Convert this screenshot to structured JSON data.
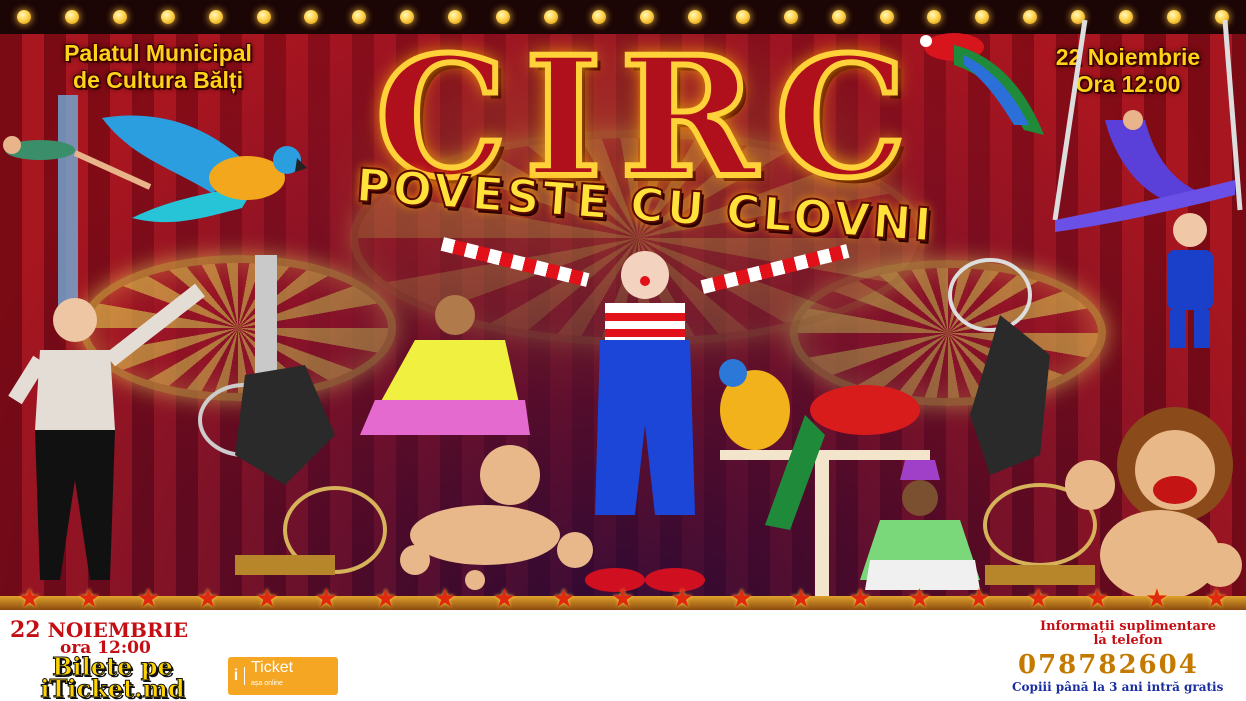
{
  "header": {
    "venue_line1": "Palatul Municipal",
    "venue_line2": "de Cultura Bălți",
    "date_line1": "22 Noiembrie",
    "date_line2": "Ora 12:00"
  },
  "title": "CIRC",
  "subtitle": "POVESTE CU CLOVNI",
  "footer": {
    "date_day": "22",
    "date_month": "NOIEMBRIE",
    "time": "ora 12:00",
    "tickets_line1": "Bilete pe",
    "tickets_line2": "iTicket.md",
    "logo_letter": "i",
    "logo_name": "Ticket",
    "logo_tag": "așa online",
    "info_line1": "Informații suplimentare",
    "info_line2": "la telefon",
    "phone": "078782604",
    "kids_note": "Copiii până la 3 ani intră gratis"
  },
  "colors": {
    "title_fill": "#b0101b",
    "title_outline": "#ffd23a",
    "header_text": "#ffd21a",
    "footer_red": "#c40e14",
    "phone_color": "#c47a00",
    "kids_note_color": "#1a2ea0",
    "logo_bg": "#f5a623"
  },
  "icons": [
    "bulb-icon",
    "star-icon",
    "parrot-icon",
    "poodle-icon",
    "monkey-icon",
    "lion-icon",
    "clown-icon",
    "acrobat-icon"
  ]
}
